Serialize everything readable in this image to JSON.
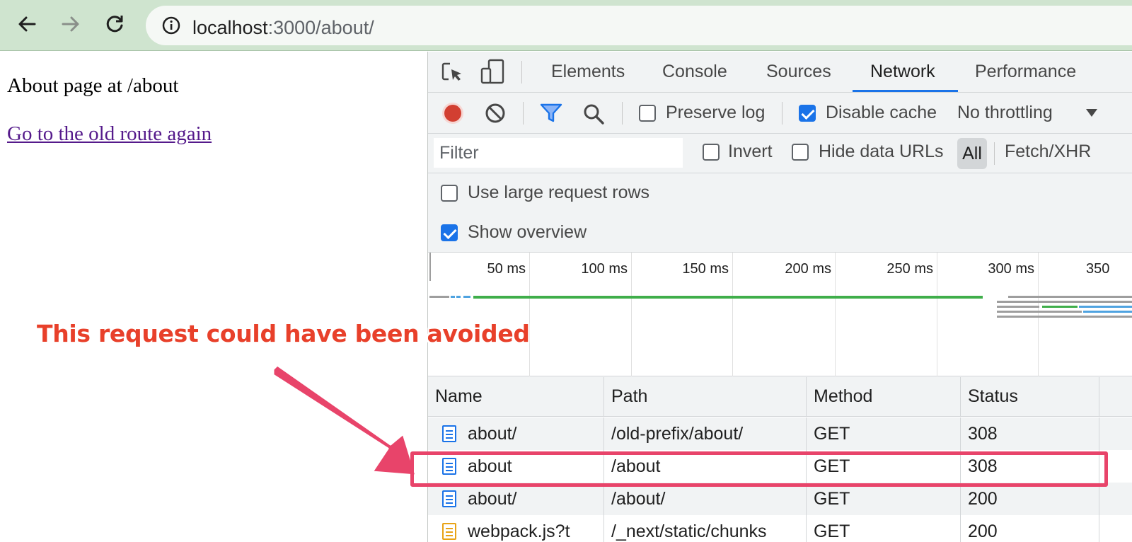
{
  "browser": {
    "url_host": "localhost",
    "url_rest": ":3000/about/"
  },
  "page": {
    "heading": "About page at /about",
    "link": "Go to the old route again"
  },
  "devtools": {
    "tabs": [
      {
        "label": "Elements",
        "active": false
      },
      {
        "label": "Console",
        "active": false
      },
      {
        "label": "Sources",
        "active": false
      },
      {
        "label": "Network",
        "active": true
      },
      {
        "label": "Performance",
        "active": false
      }
    ],
    "controls": {
      "preserve_log": "Preserve log",
      "preserve_log_checked": false,
      "disable_cache": "Disable cache",
      "disable_cache_checked": true,
      "throttling": "No throttling"
    },
    "filter": {
      "placeholder": "Filter",
      "invert": "Invert",
      "hide_data_urls": "Hide data URLs",
      "all": "All",
      "fetch_xhr": "Fetch/XHR"
    },
    "options": {
      "large_rows": "Use large request rows",
      "large_rows_checked": false,
      "show_overview": "Show overview",
      "show_overview_checked": true
    },
    "overview_ticks": [
      "50 ms",
      "100 ms",
      "150 ms",
      "200 ms",
      "250 ms",
      "300 ms",
      "350"
    ],
    "table": {
      "headers": [
        "Name",
        "Path",
        "Method",
        "Status"
      ],
      "rows": [
        {
          "name": "about/",
          "path": "/old-prefix/about/",
          "method": "GET",
          "status": "308",
          "type": "doc"
        },
        {
          "name": "about",
          "path": "/about",
          "method": "GET",
          "status": "308",
          "type": "doc"
        },
        {
          "name": "about/",
          "path": "/about/",
          "method": "GET",
          "status": "200",
          "type": "doc"
        },
        {
          "name": "webpack.js?t",
          "path": "/_next/static/chunks",
          "method": "GET",
          "status": "200",
          "type": "js"
        }
      ]
    }
  },
  "annotation": {
    "text": "This request could have been avoided"
  },
  "colors": {
    "annotation_text": "#e8402a",
    "highlight": "#e8446a",
    "accent": "#1a73e8",
    "record": "#d23f31"
  }
}
